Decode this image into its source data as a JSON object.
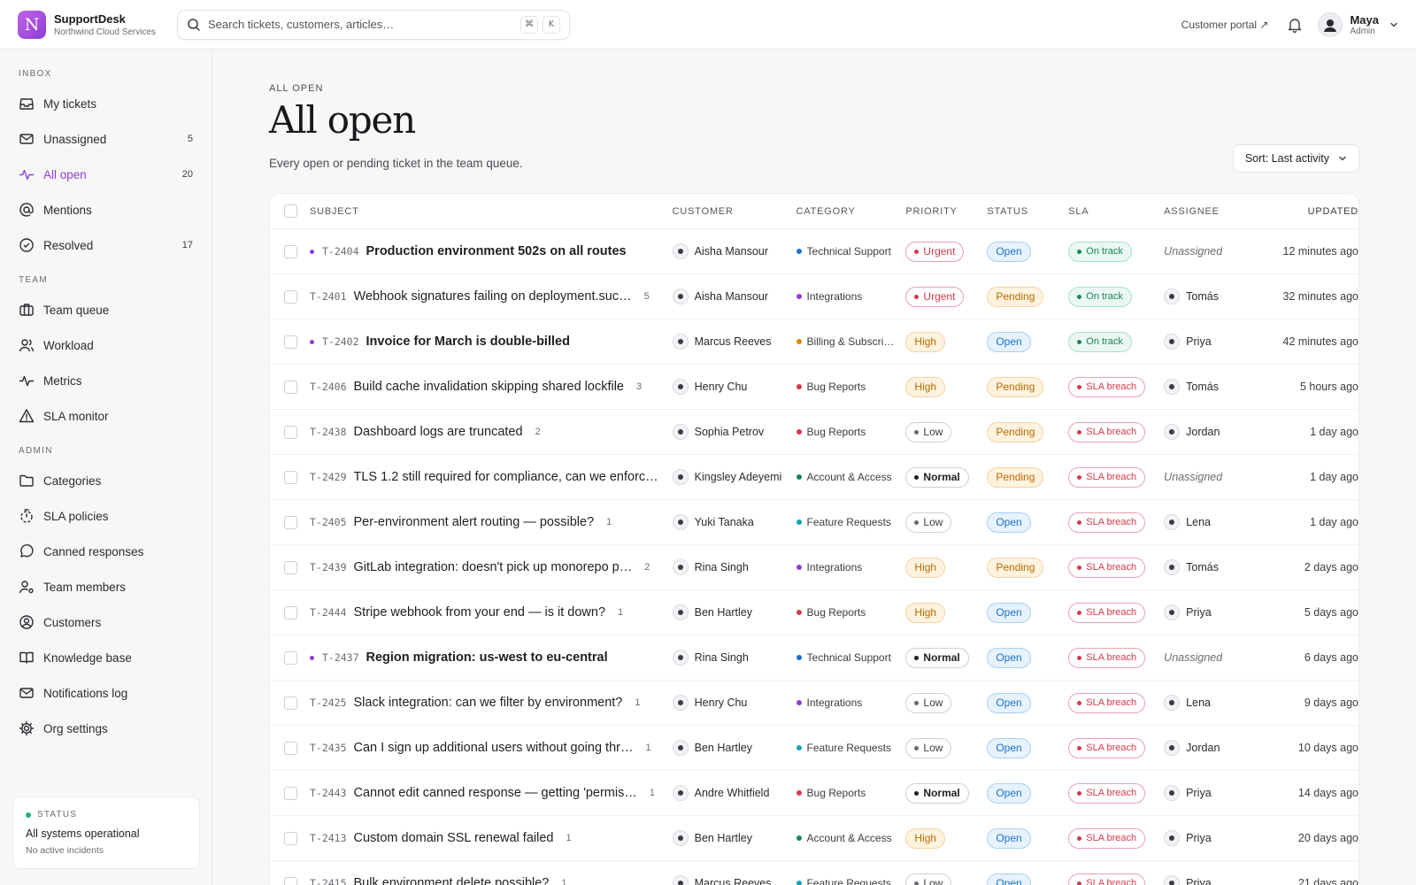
{
  "app": {
    "logo_letter": "N",
    "name": "SupportDesk",
    "org": "Northwind Cloud Services",
    "accent": "#8e3fd6"
  },
  "search": {
    "placeholder": "Search tickets, customers, articles…",
    "shortcut_1": "⌘",
    "shortcut_2": "K"
  },
  "header": {
    "portal_link": "Customer portal ↗",
    "user_name": "Maya",
    "user_role": "Admin"
  },
  "sidebar": {
    "inbox_label": "INBOX",
    "inbox": [
      {
        "label": "My tickets",
        "count": "",
        "icon": "inbox-icon"
      },
      {
        "label": "Unassigned",
        "count": "5",
        "icon": "mail-icon"
      },
      {
        "label": "All open",
        "count": "20",
        "icon": "activity-icon"
      },
      {
        "label": "Mentions",
        "count": "",
        "icon": "at-icon"
      },
      {
        "label": "Resolved",
        "count": "17",
        "icon": "check-circle-icon"
      }
    ],
    "team_label": "TEAM",
    "team": [
      {
        "label": "Team queue",
        "icon": "briefcase-icon"
      },
      {
        "label": "Workload",
        "icon": "users-icon"
      },
      {
        "label": "Metrics",
        "icon": "activity-icon"
      },
      {
        "label": "SLA monitor",
        "icon": "warning-icon"
      }
    ],
    "admin_label": "ADMIN",
    "admin": [
      {
        "label": "Categories",
        "icon": "folder-icon"
      },
      {
        "label": "SLA policies",
        "icon": "timer-icon"
      },
      {
        "label": "Canned responses",
        "icon": "chat-icon"
      },
      {
        "label": "Team members",
        "icon": "user-gear-icon"
      },
      {
        "label": "Customers",
        "icon": "user-circle-icon"
      },
      {
        "label": "Knowledge base",
        "icon": "book-icon"
      },
      {
        "label": "Notifications log",
        "icon": "mail-icon"
      },
      {
        "label": "Org settings",
        "icon": "gear-icon"
      }
    ],
    "status": {
      "label": "STATUS",
      "main": "All systems operational",
      "sub": "No active incidents"
    }
  },
  "page": {
    "eyebrow": "ALL OPEN",
    "title": "All open",
    "subtitle": "Every open or pending ticket in the team queue.",
    "sort_label": "Sort: Last activity"
  },
  "table": {
    "headers": {
      "subject": "SUBJECT",
      "customer": "CUSTOMER",
      "category": "CATEGORY",
      "priority": "PRIORITY",
      "status": "STATUS",
      "sla": "SLA",
      "assignee": "ASSIGNEE",
      "updated": "UPDATED"
    },
    "category_colors": {
      "Technical Support": "#1b73c9",
      "Integrations": "#8e3fd6",
      "Billing & Subscri…": "#e08a00",
      "Bug Reports": "#d43a4c",
      "Account & Access": "#17875c",
      "Feature Requests": "#14a3b8"
    },
    "rows": [
      {
        "unread": true,
        "id": "T-2404",
        "subject": "Production environment 502s on all routes",
        "replies": "",
        "customer": "Aisha Mansour",
        "category": "Technical Support",
        "priority": "Urgent",
        "status": "Open",
        "sla": "On track",
        "assignee": "Unassigned",
        "updated": "12 minutes ago"
      },
      {
        "unread": false,
        "id": "T-2401",
        "subject": "Webhook signatures failing on deployment.suc…",
        "replies": "5",
        "customer": "Aisha Mansour",
        "category": "Integrations",
        "priority": "Urgent",
        "status": "Pending",
        "sla": "On track",
        "assignee": "Tomás",
        "updated": "32 minutes ago"
      },
      {
        "unread": true,
        "id": "T-2402",
        "subject": "Invoice for March is double-billed",
        "replies": "",
        "customer": "Marcus Reeves",
        "category": "Billing & Subscri…",
        "priority": "High",
        "status": "Open",
        "sla": "On track",
        "assignee": "Priya",
        "updated": "42 minutes ago"
      },
      {
        "unread": false,
        "id": "T-2406",
        "subject": "Build cache invalidation skipping shared lockfile",
        "replies": "3",
        "customer": "Henry Chu",
        "category": "Bug Reports",
        "priority": "High",
        "status": "Pending",
        "sla": "SLA breach",
        "assignee": "Tomás",
        "updated": "5 hours ago"
      },
      {
        "unread": false,
        "id": "T-2438",
        "subject": "Dashboard logs are truncated",
        "replies": "2",
        "customer": "Sophia Petrov",
        "category": "Bug Reports",
        "priority": "Low",
        "status": "Pending",
        "sla": "SLA breach",
        "assignee": "Jordan",
        "updated": "1 day ago"
      },
      {
        "unread": false,
        "id": "T-2429",
        "subject": "TLS 1.2 still required for compliance, can we enforc…",
        "replies": "",
        "customer": "Kingsley Adeyemi",
        "category": "Account & Access",
        "priority": "Normal",
        "status": "Pending",
        "sla": "SLA breach",
        "assignee": "Unassigned",
        "updated": "1 day ago"
      },
      {
        "unread": false,
        "id": "T-2405",
        "subject": "Per-environment alert routing — possible?",
        "replies": "1",
        "customer": "Yuki Tanaka",
        "category": "Feature Requests",
        "priority": "Low",
        "status": "Open",
        "sla": "SLA breach",
        "assignee": "Lena",
        "updated": "1 day ago"
      },
      {
        "unread": false,
        "id": "T-2439",
        "subject": "GitLab integration: doesn't pick up monorepo p…",
        "replies": "2",
        "customer": "Rina Singh",
        "category": "Integrations",
        "priority": "High",
        "status": "Pending",
        "sla": "SLA breach",
        "assignee": "Tomás",
        "updated": "2 days ago"
      },
      {
        "unread": false,
        "id": "T-2444",
        "subject": "Stripe webhook from your end — is it down?",
        "replies": "1",
        "customer": "Ben Hartley",
        "category": "Bug Reports",
        "priority": "High",
        "status": "Open",
        "sla": "SLA breach",
        "assignee": "Priya",
        "updated": "5 days ago"
      },
      {
        "unread": true,
        "id": "T-2437",
        "subject": "Region migration: us-west to eu-central",
        "replies": "",
        "customer": "Rina Singh",
        "category": "Technical Support",
        "priority": "Normal",
        "status": "Open",
        "sla": "SLA breach",
        "assignee": "Unassigned",
        "updated": "6 days ago"
      },
      {
        "unread": false,
        "id": "T-2425",
        "subject": "Slack integration: can we filter by environment?",
        "replies": "1",
        "customer": "Henry Chu",
        "category": "Integrations",
        "priority": "Low",
        "status": "Open",
        "sla": "SLA breach",
        "assignee": "Lena",
        "updated": "9 days ago"
      },
      {
        "unread": false,
        "id": "T-2435",
        "subject": "Can I sign up additional users without going thr…",
        "replies": "1",
        "customer": "Ben Hartley",
        "category": "Feature Requests",
        "priority": "Low",
        "status": "Open",
        "sla": "SLA breach",
        "assignee": "Jordan",
        "updated": "10 days ago"
      },
      {
        "unread": false,
        "id": "T-2443",
        "subject": "Cannot edit canned response — getting 'permis…",
        "replies": "1",
        "customer": "Andre Whitfield",
        "category": "Bug Reports",
        "priority": "Normal",
        "status": "Open",
        "sla": "SLA breach",
        "assignee": "Priya",
        "updated": "14 days ago"
      },
      {
        "unread": false,
        "id": "T-2413",
        "subject": "Custom domain SSL renewal failed",
        "replies": "1",
        "customer": "Ben Hartley",
        "category": "Account & Access",
        "priority": "High",
        "status": "Open",
        "sla": "SLA breach",
        "assignee": "Priya",
        "updated": "20 days ago"
      },
      {
        "unread": false,
        "id": "T-2415",
        "subject": "Bulk environment delete possible?",
        "replies": "1",
        "customer": "Marcus Reeves",
        "category": "Feature Requests",
        "priority": "Low",
        "status": "Open",
        "sla": "SLA breach",
        "assignee": "Priya",
        "updated": "21 days ago"
      }
    ]
  }
}
